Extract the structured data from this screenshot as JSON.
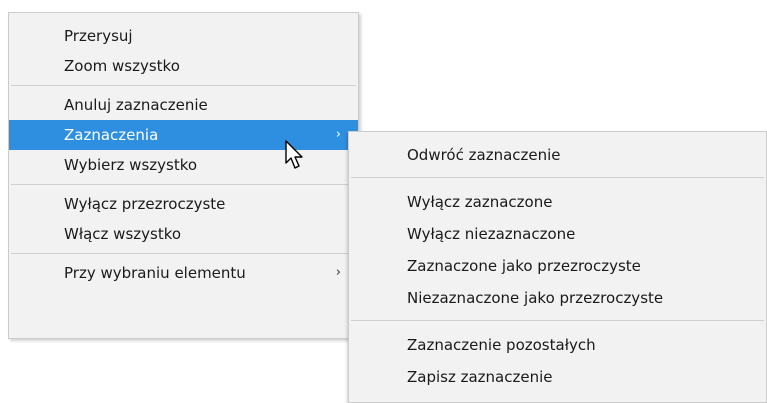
{
  "main_menu": {
    "items": [
      {
        "label": "Przerysuj"
      },
      {
        "label": "Zoom wszystko"
      },
      {
        "label": "Anuluj zaznaczenie"
      },
      {
        "label": "Zaznaczenia",
        "arrow": "›"
      },
      {
        "label": "Wybierz wszystko"
      },
      {
        "label": "Wyłącz przezroczyste"
      },
      {
        "label": "Włącz wszystko"
      },
      {
        "label": "Przy wybraniu elementu",
        "arrow": "›"
      }
    ],
    "highlighted_index": 3
  },
  "sub_menu": {
    "items": [
      {
        "label": "Odwróć zaznaczenie"
      },
      {
        "label": "Wyłącz zaznaczone"
      },
      {
        "label": "Wyłącz niezaznaczone"
      },
      {
        "label": "Zaznaczone jako przezroczyste"
      },
      {
        "label": "Niezaznaczone jako przezroczyste"
      },
      {
        "label": "Zaznaczenie pozostałych"
      },
      {
        "label": "Zapisz zaznaczenie"
      }
    ]
  },
  "cursor_icon": "mouse-pointer-icon",
  "colors": {
    "menu_bg": "#f2f2f2",
    "highlight": "#2e8fe0",
    "separator": "#cfcfcf",
    "text": "#1a1a1a"
  }
}
